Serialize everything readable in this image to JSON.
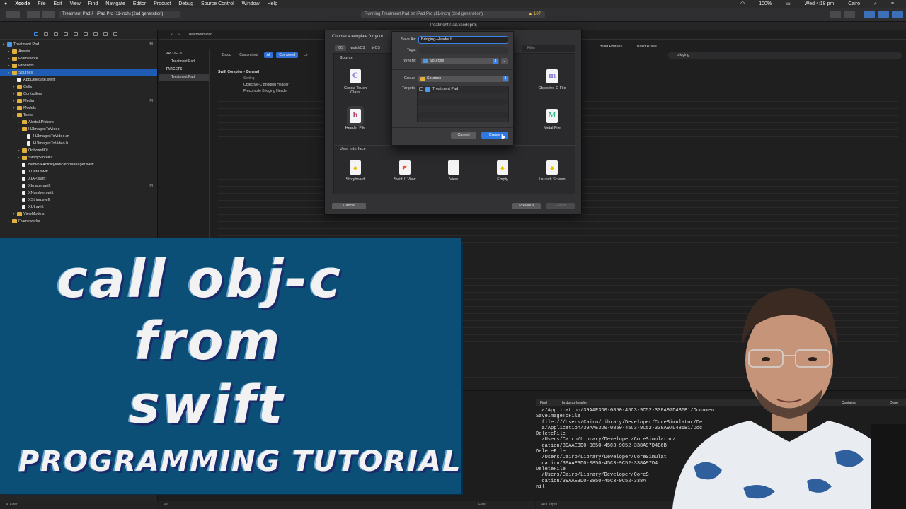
{
  "menubar": {
    "app": "Xcode",
    "items": [
      "File",
      "Edit",
      "View",
      "Find",
      "Navigate",
      "Editor",
      "Product",
      "Debug",
      "Source Control",
      "Window",
      "Help"
    ],
    "battery": "100%",
    "clock": "Wed 4:18 pm",
    "user": "Cairo"
  },
  "toolbar": {
    "scheme": "Treatment Pad  〉  iPad Pro (11-inch) (2nd generation)",
    "status": "Running Treatment Pad on iPad Pro (11-inch) (2nd generation)",
    "warnings": "107"
  },
  "tabbar": {
    "title": "Treatment Pad.xcodeproj"
  },
  "navigator": {
    "items": [
      {
        "label": "Treatment Pad",
        "indent": 0,
        "kind": "project",
        "mark": "M"
      },
      {
        "label": "Assets",
        "indent": 1,
        "kind": "folder"
      },
      {
        "label": "Framework",
        "indent": 1,
        "kind": "folder"
      },
      {
        "label": "Products",
        "indent": 1,
        "kind": "folder"
      },
      {
        "label": "Sources",
        "indent": 1,
        "kind": "folder",
        "selected": true
      },
      {
        "label": "AppDelegate.swift",
        "indent": 2,
        "kind": "file"
      },
      {
        "label": "Cells",
        "indent": 2,
        "kind": "folder"
      },
      {
        "label": "Controllers",
        "indent": 2,
        "kind": "folder"
      },
      {
        "label": "Media",
        "indent": 2,
        "kind": "folder",
        "mark": "M"
      },
      {
        "label": "Models",
        "indent": 2,
        "kind": "folder"
      },
      {
        "label": "Tools",
        "indent": 2,
        "kind": "folder"
      },
      {
        "label": "Alerts&Pickers",
        "indent": 3,
        "kind": "folder"
      },
      {
        "label": "HJImagesToVideo",
        "indent": 3,
        "kind": "folder"
      },
      {
        "label": "HJImagesToVideo.m",
        "indent": 4,
        "kind": "file"
      },
      {
        "label": "HJImagesToVideo.h",
        "indent": 4,
        "kind": "file"
      },
      {
        "label": "OnboardKit",
        "indent": 3,
        "kind": "folder"
      },
      {
        "label": "SwiftyStoreKit",
        "indent": 3,
        "kind": "folder"
      },
      {
        "label": "NetworkActivityIndicatorManager.swift",
        "indent": 3,
        "kind": "file"
      },
      {
        "label": "XData.swift",
        "indent": 3,
        "kind": "file"
      },
      {
        "label": "XIAP.swift",
        "indent": 3,
        "kind": "file"
      },
      {
        "label": "XImage.swift",
        "indent": 3,
        "kind": "file",
        "mark": "M"
      },
      {
        "label": "XNumber.swift",
        "indent": 3,
        "kind": "file"
      },
      {
        "label": "XString.swift",
        "indent": 3,
        "kind": "file"
      },
      {
        "label": "XUI.swift",
        "indent": 3,
        "kind": "file"
      },
      {
        "label": "ViewModels",
        "indent": 2,
        "kind": "folder"
      },
      {
        "label": "Frameworks",
        "indent": 1,
        "kind": "folder"
      }
    ],
    "filter_placeholder": "Filter"
  },
  "editor": {
    "jump": "Treatment Pad",
    "project_hdr": "PROJECT",
    "project_item": "Treatment Pad",
    "targets_hdr": "TARGETS",
    "target_item": "Treatment Pad",
    "tabs": [
      "Basic",
      "Customized",
      "All",
      "Combined",
      "Le"
    ],
    "section": "Swift Compiler - General",
    "col": "Setting",
    "rows": [
      "Objective-C Bridging Header",
      "Precompile Bridging Header"
    ],
    "right_tabs": [
      "Build Phases",
      "Build Rules"
    ],
    "search": "bridging"
  },
  "template_dialog": {
    "title": "Choose a template for your",
    "platforms": [
      "iOS",
      "watchOS",
      "tvOS"
    ],
    "filter": "Filter",
    "source_label": "Source",
    "ui_label": "User Interface",
    "source_items": [
      {
        "label": "Cocoa Touch Class",
        "glyph": "C"
      },
      {
        "label": "Objective-C File",
        "glyph": "m"
      },
      {
        "label": "Header File",
        "glyph": "h"
      },
      {
        "label": "Metal File",
        "glyph": "M"
      }
    ],
    "ui_items": [
      {
        "label": "Storyboard",
        "glyph": "◆"
      },
      {
        "label": "SwiftUI View",
        "glyph": "◤"
      },
      {
        "label": "View",
        "glyph": ""
      },
      {
        "label": "Empty",
        "glyph": "◆"
      },
      {
        "label": "Launch Screen",
        "glyph": "◆"
      }
    ],
    "cancel": "Cancel",
    "previous": "Previous",
    "finish": "Finish"
  },
  "save_sheet": {
    "save_as_label": "Save As:",
    "save_as_value": "Bridging-Header.h",
    "tags_label": "Tags:",
    "where_label": "Where:",
    "where_value": "Sources",
    "group_label": "Group",
    "group_value": "Sources",
    "targets_label": "Targets",
    "target_value": "Treatment Pad",
    "cancel": "Cancel",
    "create": "Create"
  },
  "debug": {
    "find_label": "Find",
    "find_value": "bridging-header",
    "contains": "Contains",
    "done": "Done",
    "console": "  a/Application/39AAE3D0-0850-45C3-9C52-338A97D4B6B1/Documen\nSaveImageToFile\n  file:///Users/Cairo/Library/Developer/CoreSimulator/De\n  a/Application/39AAE3D0-0850-45C3-9C52-338A97D4B6B1/Doc\nDeleteFile\n  /Users/Cairo/Library/Developer/CoreSimulator/\n  cation/39AAE3D0-0850-45C3-9C52-338A97D4B6B\nDeleteFile\n  /Users/Cairo/Library/Developer/CoreSimulat\n  cation/39AAE3D0-0850-45C3-9C52-338A97D4\nDeleteFile\n  /Users/Cairo/Library/Developer/CoreS\n  cation/39AAE3D0-0850-45C3-9C52-338A\nnil",
    "all_output": "All Output",
    "filter": "Filter",
    "all": "All"
  },
  "banner": {
    "line1": "call obj-c",
    "line2": "from",
    "line3": "swift",
    "line4": "PROGRAMMING TUTORIAL",
    "bg_color": "#0b4f77"
  },
  "colors": {
    "accent": "#2f6fd6",
    "folder": "#e0b23c"
  }
}
